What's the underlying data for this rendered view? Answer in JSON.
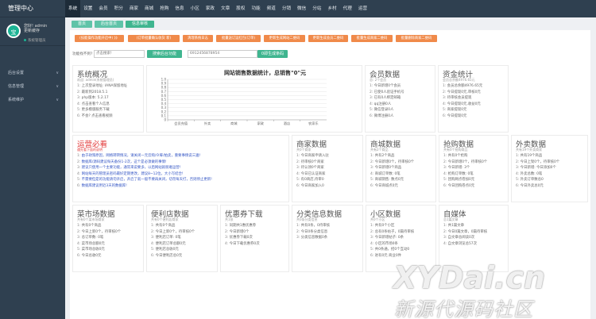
{
  "sidebar": {
    "brand": "管理中心",
    "avatar_text": "宝",
    "greeting": "您好! admin",
    "change_pwd": "更新缓存",
    "role": "系统管理员",
    "items": [
      {
        "label": "后台设置"
      },
      {
        "label": "信息管理"
      },
      {
        "label": "系统维护"
      }
    ]
  },
  "topnav": [
    "系统",
    "设置",
    "会员",
    "积分",
    "商家",
    "商城",
    "抢购",
    "信息",
    "小区",
    "家政",
    "文章",
    "股权",
    "功能",
    "频道",
    "分销",
    "微信",
    "分站",
    "乡村",
    "代理",
    "运营"
  ],
  "crumbs": [
    "首页",
    "后台首页",
    "信息审核"
  ],
  "action_buttons": [
    "(技能操作功能开启中) 》》",
    "(订单批量确认收货 新)",
    "清理系统日志",
    "批量送订运红包(订单)",
    "更新生成网站二维码",
    "更新生成会员二维码",
    "批量生成商家二维码",
    "批量删除商家二维码"
  ],
  "form": {
    "func_label": "功能找不到?",
    "search_placeholder": "点击搜索!",
    "admin_btn": "搜索后台功能",
    "phone_value": "6912456878954",
    "qr_btn": "0即生成条码"
  },
  "panels": {
    "system": {
      "title": "系统概况",
      "sub": "欢迎: admin(系统管理员)",
      "items": [
        "1: 上次登录地址: IANA保留地址",
        "2: 最新到2018.5.1",
        "3: php版本: 5.2.17",
        "4: 点击查看个人信息",
        "5: 更多模版服务下载",
        "6: 不会? 点击查看视频"
      ]
    },
    "chart": {
      "title": "网站销售数据统计，总销售\"0\"元"
    },
    "member": {
      "title": "会员数据",
      "sub": "总: 2个会员",
      "items": [
        "1: 今日新增0个会员",
        "2: 已使0人验证手机号",
        "3: 已有0人绑定邮箱",
        "4: qq注册0人",
        "5: 微信登录0人",
        "6: 微博注册0人"
      ]
    },
    "funds": {
      "title": "资金统计",
      "sub": "会员总余额4976.65元",
      "items": [
        "1: 会员总余额4976.65元",
        "2: 今日提现0元,审核0元",
        "3: 待审核会员提现",
        "4: 今日提现0元,收益0元",
        "5: 商家提现0元",
        "6: 今日提现0元"
      ]
    },
    "must": {
      "title": "运营必看",
      "sub": "遇先看下面的说明",
      "items": [
        "1: 由于政策原因，网络转转情况，请关闭一元云购/众筹/拍卖，重要事情说三遍!",
        "2: 数据库/源码建议每天备份1-2次，这个是必须做的事情!",
        "3: 建议只使用一个主要功能，通常来说要多，以后网站就很难运营!",
        "4: 网站每天的管理员密码最好定期更改，建议8~12位，大小写结合!",
        "5: 不需要但是的功能请勿开启，开启了就一般不要再关闭，切勿每天打，否则停止更新!",
        "6: 数据库建议用近3天的数据库!"
      ]
    },
    "shop": {
      "title": "商家数据",
      "sub": "共0个商家",
      "items": [
        "1: 今日商家申请入驻",
        "2: 待审核0个商家",
        "3: 待认领0个商家",
        "4: 今日已认证商家",
        "5: 有0商店,待审0",
        "6: 今日商家加入0"
      ]
    },
    "mall": {
      "title": "商城数据",
      "sub": "共有2个商品",
      "items": [
        "1: 共有2个商品",
        "2: 今日新增0个，待审核0个",
        "3: 今日新增0个商品",
        "4: 商城订单数: 0笔",
        "5: 商城销售: 数点0元",
        "6: 今日商城点0元"
      ]
    },
    "flash": {
      "title": "抢购数据",
      "sub": "共有0个抢购商品",
      "items": [
        "1: 共有0个抢购",
        "2: 今日新增0个，待审核0个",
        "3: 今日新增: 3个",
        "4: 抢购订单数: 0笔",
        "5: 团购网点卷加0元",
        "6: 今日团购卷点0元"
      ]
    },
    "takeout": {
      "title": "外卖数据",
      "sub": "共有19个外卖商家",
      "items": [
        "1: 共有19个商品",
        "2: 今日上架0个，待审核0个",
        "3: 今日新增: 今日添加0个",
        "4: 外卖总数: 0笔",
        "5: 外卖订单数总0",
        "6: 今日外卖总0元"
      ]
    },
    "market": {
      "title": "菜市场数据",
      "sub": "共有0个菜市场商家",
      "items": [
        "1: 共有0个商品",
        "2: 今日上新0个，待审核0个",
        "3: 总订单数: 0笔",
        "4: 菜市场总额0元",
        "5: 菜市场总收0元",
        "6: 今日总收0元"
      ]
    },
    "store": {
      "title": "便利店数据",
      "sub": "共有0个便利店商家",
      "items": [
        "1: 共有0个商品",
        "2: 今日上新0个，待审核0个",
        "3: 便利店订单: 0笔",
        "4: 便利店订单总额0元",
        "5: 便利店总收0元",
        "6: 今日便利店总0元"
      ]
    },
    "coupon": {
      "title": "优惠券下载",
      "sub": "共1张",
      "items": [
        "1: 同期共1惠优惠券",
        "2: 今日新增0个",
        "3: 优惠券下载0次",
        "4: 今日下载优惠券0次"
      ]
    },
    "classified": {
      "title": "分类信息数据",
      "sub": "共0条分类信息",
      "items": [
        "1: 共有0条，0待审核",
        "2: 今日0条分类信息",
        "3: 分类信息数据0条"
      ]
    },
    "community": {
      "title": "小区数据",
      "sub": "共0个小区",
      "items": [
        "1: 共有0个小区",
        "2: 总有0条帖子，0篇待审核",
        "3: 今日新增帖子: 0条",
        "4: 小区的市场0条",
        "5: 共0条通，招0个互动0",
        "6: 进有0元 商业0件"
      ]
    },
    "media": {
      "title": "自媒体",
      "sub": "总1篇文章",
      "items": [
        "1: 共1篇文章",
        "2: 今日0篇文章，0篇待审核",
        "3: 自文章总阅读0次",
        "4: 自文章浏览总57次"
      ]
    }
  },
  "chart_data": {
    "type": "bar",
    "title": "网站销售数据统计，总销售\"0\"元",
    "categories": [
      "会员充值",
      "外卖",
      "商城",
      "家政",
      "酒店",
      "农家乐"
    ],
    "values": [
      0,
      0,
      0,
      0,
      0,
      0
    ],
    "ylim": [
      0,
      1
    ],
    "yticks": [
      "1.0",
      "0.9",
      "0.8",
      "0.7",
      "0.6",
      "0.5",
      "0.4",
      "0.3",
      "0.2",
      "0.1",
      "0"
    ]
  },
  "watermark": {
    "line1": "XYDai.cn",
    "line2": "新源代源码社区"
  }
}
